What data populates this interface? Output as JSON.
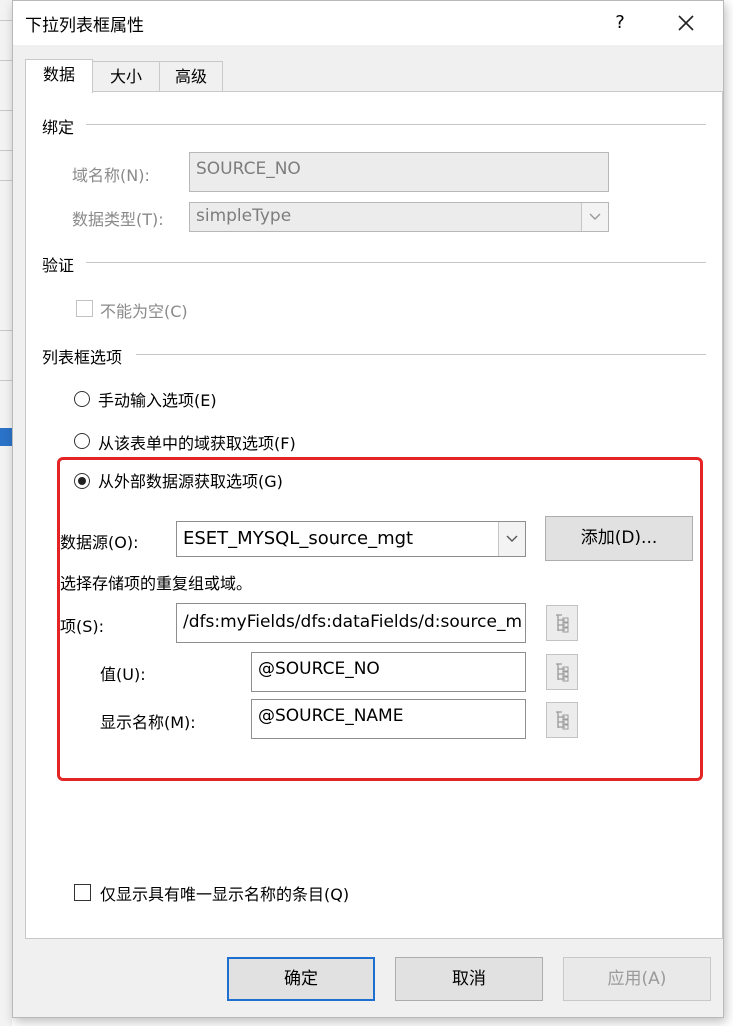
{
  "window": {
    "title": "下拉列表框属性",
    "help": "?",
    "close": "✕"
  },
  "tabs": [
    {
      "label": "数据"
    },
    {
      "label": "大小"
    },
    {
      "label": "高级"
    }
  ],
  "binding": {
    "heading": "绑定",
    "field_name_label": "域名称(N):",
    "field_name_value": "SOURCE_NO",
    "data_type_label": "数据类型(T):",
    "data_type_value": "simpleType"
  },
  "validation": {
    "heading": "验证",
    "not_blank_label": "不能为空(C)"
  },
  "list_options": {
    "heading": "列表框选项",
    "manual": "手动输入选项(E)",
    "from_form": "从该表单中的域获取选项(F)",
    "from_external": "从外部数据源获取选项(G)",
    "selected": "from_external"
  },
  "external": {
    "datasource_label": "数据源(O):",
    "datasource_value": "ESET_MYSQL_source_mgt",
    "add_button": "添加(D)...",
    "hint": "选择存储项的重复组或域。",
    "entries_label": "项(S):",
    "entries_value": "/dfs:myFields/dfs:dataFields/d:source_m",
    "value_label": "值(U):",
    "value_value": "@SOURCE_NO",
    "display_label": "显示名称(M):",
    "display_value": "@SOURCE_NAME"
  },
  "unique_only_label": "仅显示具有唯一显示名称的条目(Q)",
  "buttons": {
    "ok": "确定",
    "cancel": "取消",
    "apply": "应用(A)"
  },
  "colors": {
    "highlight_frame": "#e32424",
    "default_button_border": "#1f6fd0"
  },
  "icons": {
    "close": "close-icon",
    "tree": "tree-view-icon",
    "dropdown": "chevron-down-icon"
  }
}
